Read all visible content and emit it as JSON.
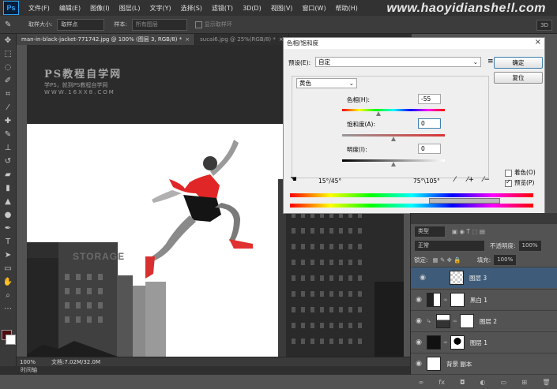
{
  "app": {
    "logo": "Ps"
  },
  "menu": [
    "文件(F)",
    "编辑(E)",
    "图像(I)",
    "图层(L)",
    "文字(Y)",
    "选择(S)",
    "滤镜(T)",
    "3D(D)",
    "视图(V)",
    "窗口(W)",
    "帮助(H)"
  ],
  "watermark_url": "www.haoyidianshe!l.com",
  "options_bar": {
    "sample_size_label": "取样大小:",
    "sample_size_value": "取样点",
    "sample_label": "样本:",
    "sample_value": "所有图层",
    "show_ring_label": "显示取样环",
    "workspace": "3D"
  },
  "tabs": [
    {
      "label": "man-in-black-jacket-771742.jpg @ 100% (图层 3, RGB/8) *",
      "active": true
    },
    {
      "label": "sucai6.jpg @ 25%(RGB/8) *",
      "active": false
    }
  ],
  "canvas_watermark": {
    "title": "PS教程自学网",
    "sub": "学PS，就到PS教程自学网",
    "url": "WWW.16XX8.COM"
  },
  "building_sign": "STORAGE",
  "status": {
    "zoom": "100%",
    "doc": "文档:7.02M/32.0M"
  },
  "timeline_label": "时间轴",
  "dialog": {
    "title": "色相/饱和度",
    "preset_label": "预设(E):",
    "preset_value": "自定",
    "channel": "黄色",
    "hue_label": "色相(H):",
    "hue_value": "-55",
    "saturation_label": "饱和度(A):",
    "saturation_value": "0",
    "lightness_label": "明度(I):",
    "lightness_value": "0",
    "range_left": "15°/45°",
    "range_right": "75°\\105°",
    "ok": "确定",
    "reset": "复位",
    "colorize_label": "着色(O)",
    "preview_label": "预览(P)",
    "preview_checked": true,
    "hue_position": 0.35,
    "saturation_position": 0.5,
    "lightness_position": 0.5
  },
  "layers_panel": {
    "filter_label": "类型",
    "blend_mode": "正常",
    "opacity_label": "不透明度:",
    "opacity_value": "100%",
    "lock_label": "锁定:",
    "fill_label": "填充:",
    "fill_value": "100%",
    "layers": [
      {
        "name": "图层 3",
        "selected": true,
        "thumb": "checker"
      },
      {
        "name": "黑白 1",
        "selected": false,
        "thumb": "adjustment"
      },
      {
        "name": "图层 2",
        "selected": false,
        "thumb": "city"
      },
      {
        "name": "图层 1",
        "selected": false,
        "thumb": "figure"
      },
      {
        "name": "背景 副本",
        "selected": false,
        "thumb": "white"
      }
    ]
  },
  "colors": {
    "foreground": "#4a0d10",
    "background": "#ffffff",
    "selection": "#3e5c79"
  }
}
